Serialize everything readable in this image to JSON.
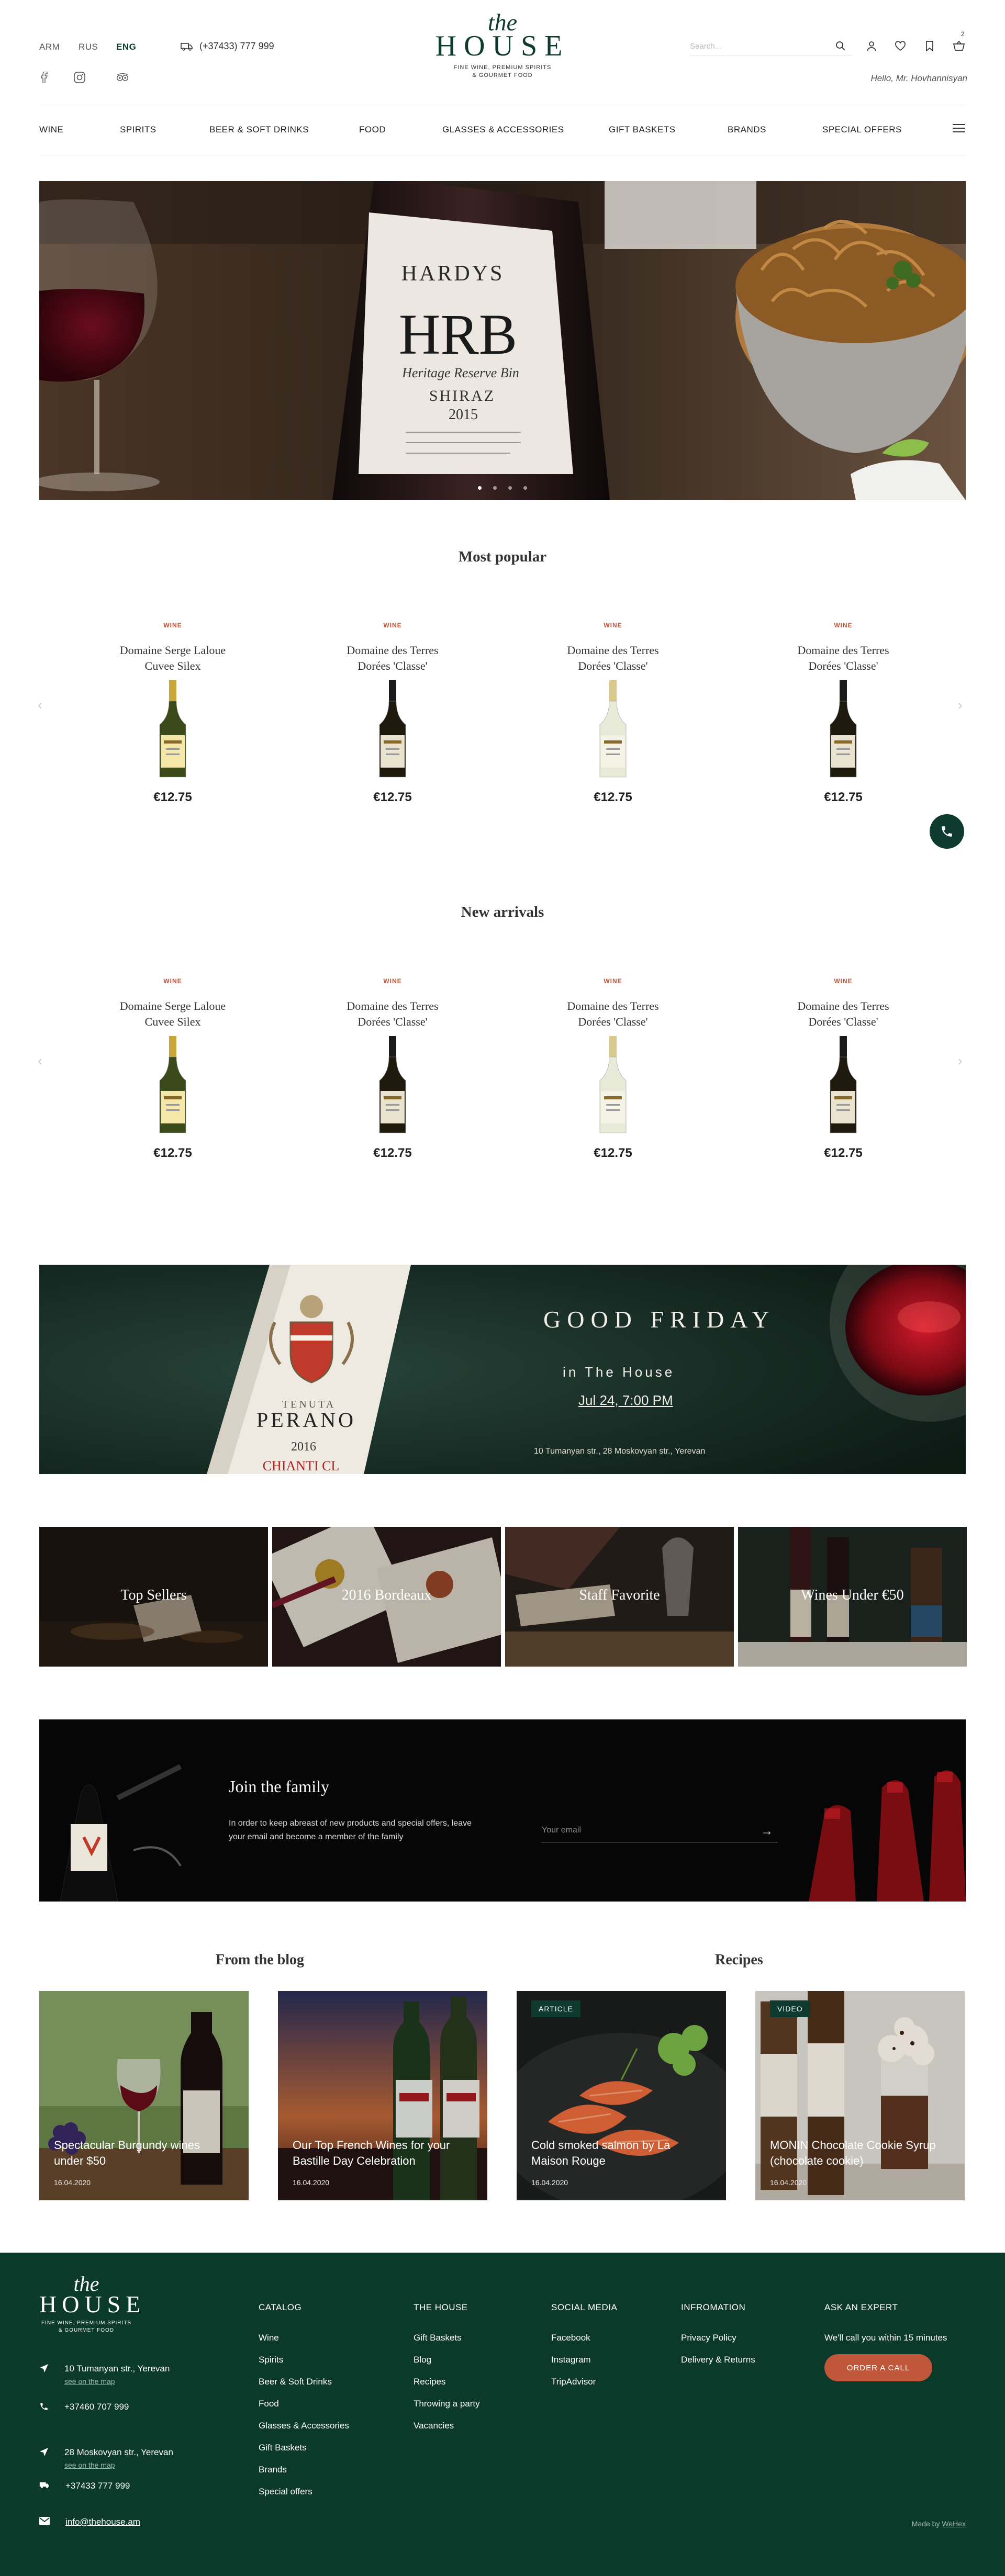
{
  "header": {
    "languages": [
      "ARM",
      "RUS",
      "ENG"
    ],
    "active_language": "ENG",
    "phone": "(+37433) 777 999",
    "logo": {
      "the": "the",
      "house": "HOUSE",
      "tagline_1": "FINE WINE, PREMIUM SPIRITS",
      "tagline_2": "& GOURMET FOOD"
    },
    "search_placeholder": "Search...",
    "cart_count": "2",
    "greeting": "Hello, Mr. Hovhannisyan",
    "social_icons": [
      "facebook-icon",
      "instagram-icon",
      "tripadvisor-icon"
    ]
  },
  "nav": {
    "items": [
      "WINE",
      "SPIRITS",
      "BEER & SOFT DRINKS",
      "FOOD",
      "GLASSES & ACCESSORIES",
      "GIFT BASKETS",
      "BRANDS",
      "SPECIAL OFFERS"
    ]
  },
  "hero": {
    "label_brand": "HARDYS",
    "label_title": "HRB",
    "label_sub": "Heritage Reserve Bin",
    "label_variety": "SHIRAZ",
    "label_year": "2015",
    "slides": 4,
    "active_slide": 0
  },
  "most_popular": {
    "title": "Most popular",
    "products": [
      {
        "category": "WINE",
        "name_1": "Domaine Serge Laloue",
        "name_2": "Cuvee Silex",
        "price": "€12.75",
        "bottle": "white"
      },
      {
        "category": "WINE",
        "name_1": "Domaine des Terres",
        "name_2": "Dorées 'Classe'",
        "price": "€12.75",
        "bottle": "dark"
      },
      {
        "category": "WINE",
        "name_1": "Domaine des Terres",
        "name_2": "Dorées 'Classe'",
        "price": "€12.75",
        "bottle": "clear"
      },
      {
        "category": "WINE",
        "name_1": "Domaine des Terres",
        "name_2": "Dorées 'Classe'",
        "price": "€12.75",
        "bottle": "dark"
      }
    ]
  },
  "new_arrivals": {
    "title": "New arrivals",
    "products": [
      {
        "category": "WINE",
        "name_1": "Domaine Serge Laloue",
        "name_2": "Cuvee Silex",
        "price": "€12.75",
        "bottle": "white"
      },
      {
        "category": "WINE",
        "name_1": "Domaine des Terres",
        "name_2": "Dorées 'Classe'",
        "price": "€12.75",
        "bottle": "dark"
      },
      {
        "category": "WINE",
        "name_1": "Domaine des Terres",
        "name_2": "Dorées 'Classe'",
        "price": "€12.75",
        "bottle": "clear"
      },
      {
        "category": "WINE",
        "name_1": "Domaine des Terres",
        "name_2": "Dorées 'Classe'",
        "price": "€12.75",
        "bottle": "dark"
      }
    ]
  },
  "event": {
    "title": "GOOD FRIDAY",
    "subtitle": "in The House",
    "date": "Jul 24, 7:00 PM",
    "address": "10 Tumanyan str., 28 Moskovyan str., Yerevan",
    "bottle_brand": "PERANO",
    "bottle_estate": "TENUTA",
    "bottle_year": "2016",
    "bottle_name": "CHIANTI CL"
  },
  "categories": [
    {
      "label": "Top Sellers"
    },
    {
      "label": "2016 Bordeaux"
    },
    {
      "label": "Staff Favorite"
    },
    {
      "label": "Wines Under €50"
    }
  ],
  "newsletter": {
    "title": "Join the family",
    "text": "In order to keep abreast of new products and special offers, leave your email and become a member of the family",
    "email_placeholder": "Your email"
  },
  "blog": {
    "title": "From the blog",
    "recipes_title": "Recipes",
    "posts": [
      {
        "title": "Spectacular Burgundy wines under $50",
        "date": "16.04.2020",
        "badge": ""
      },
      {
        "title": "Our Top French Wines for your Bastille Day Celebration",
        "date": "16.04.2020",
        "badge": ""
      },
      {
        "title": "Cold smoked salmon by La Maison Rouge",
        "date": "16.04.2020",
        "badge": "ARTICLE"
      },
      {
        "title": "MONIN Chocolate Cookie Syrup (chocolate cookie)",
        "date": "16.04.2020",
        "badge": "VIDEO"
      }
    ]
  },
  "footer": {
    "logo": {
      "the": "the",
      "house": "HOUSE",
      "tagline_1": "FINE WINE, PREMIUM SPIRITS",
      "tagline_2": "& GOURMET FOOD"
    },
    "address_1": "10 Tumanyan str., Yerevan",
    "address_1_map": "see on the map",
    "phone_1": "+37460 707 999",
    "address_2": "28 Moskovyan str., Yerevan",
    "address_2_map": "see on the map",
    "phone_2": "+37433 777 999",
    "email": "info@thehouse.am",
    "catalog": {
      "title": "CATALOG",
      "items": [
        "Wine",
        "Spirits",
        "Beer & Soft Drinks",
        "Food",
        "Glasses & Accessories",
        "Gift Baskets",
        "Brands",
        "Special offers"
      ]
    },
    "the_house": {
      "title": "THE HOUSE",
      "items": [
        "Gift Baskets",
        "Blog",
        "Recipes",
        "Throwing a party",
        "Vacancies"
      ]
    },
    "social": {
      "title": "SOCIAL MEDIA",
      "items": [
        "Facebook",
        "Instagram",
        "TripAdvisor"
      ]
    },
    "info": {
      "title": "INFROMATION",
      "items": [
        "Privacy Policy",
        "Delivery & Returns"
      ]
    },
    "expert": {
      "title": "ASK AN EXPERT",
      "text": "We'll call you within 15 minutes",
      "button": "ORDER A CALL"
    },
    "made_by": "Made by",
    "made_by_link": "WeHex"
  },
  "colors": {
    "brand_green": "#0b3a2b",
    "accent_orange": "#c0563a"
  }
}
